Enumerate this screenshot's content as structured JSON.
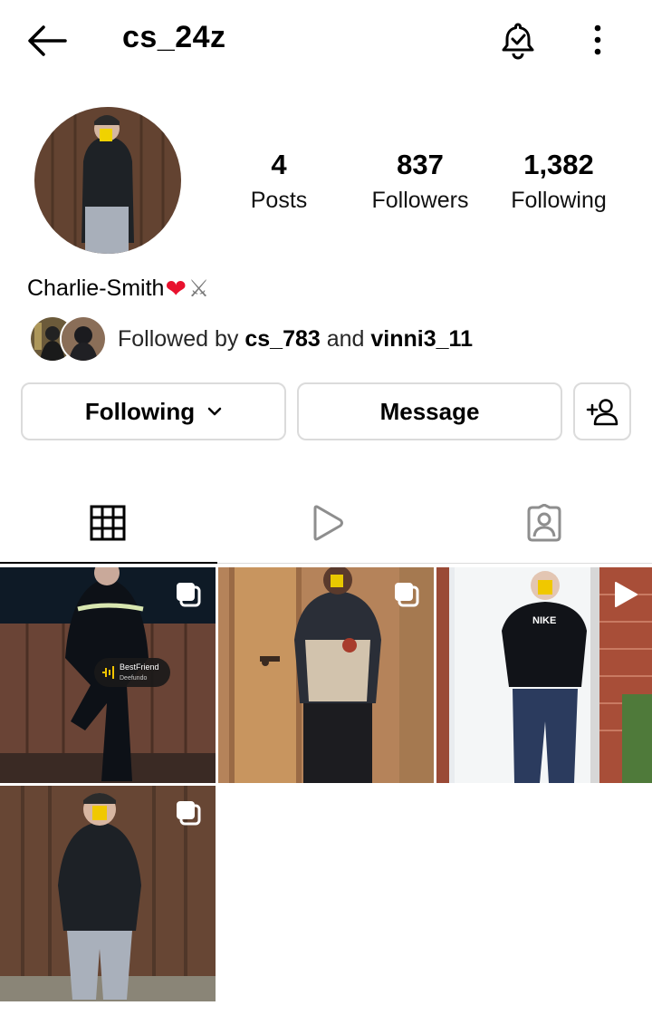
{
  "header": {
    "username": "cs_24z",
    "icons": [
      "back-arrow-icon",
      "bell-check-icon",
      "more-vertical-icon"
    ]
  },
  "profile": {
    "display_name": "Charlie-Smith",
    "name_emojis": [
      "❤",
      "⚔"
    ],
    "stats": {
      "posts_count": "4",
      "posts_label": "Posts",
      "followers_count": "837",
      "followers_label": "Followers",
      "following_count": "1,382",
      "following_label": "Following"
    },
    "followed_by": {
      "prefix": "Followed by ",
      "user1": "cs_783",
      "joiner": " and ",
      "user2": "vinni3_11"
    }
  },
  "actions": {
    "following_label": "Following",
    "message_label": "Message",
    "add_icon": "person-plus-icon"
  },
  "tabs": {
    "items": [
      "grid-icon",
      "reels-play-icon",
      "tagged-person-icon"
    ],
    "active": "grid-icon"
  },
  "posts": {
    "items": [
      {
        "type": "carousel",
        "overlay_text_1": "BestFriend",
        "overlay_text_2": "Deefundo"
      },
      {
        "type": "carousel"
      },
      {
        "type": "reel"
      },
      {
        "type": "carousel"
      }
    ]
  },
  "colors": {
    "text": "#000000",
    "muted": "#262626",
    "border": "#dbdbdb",
    "heart": "#e8112d",
    "inactive_icon": "#8e8e8e"
  }
}
